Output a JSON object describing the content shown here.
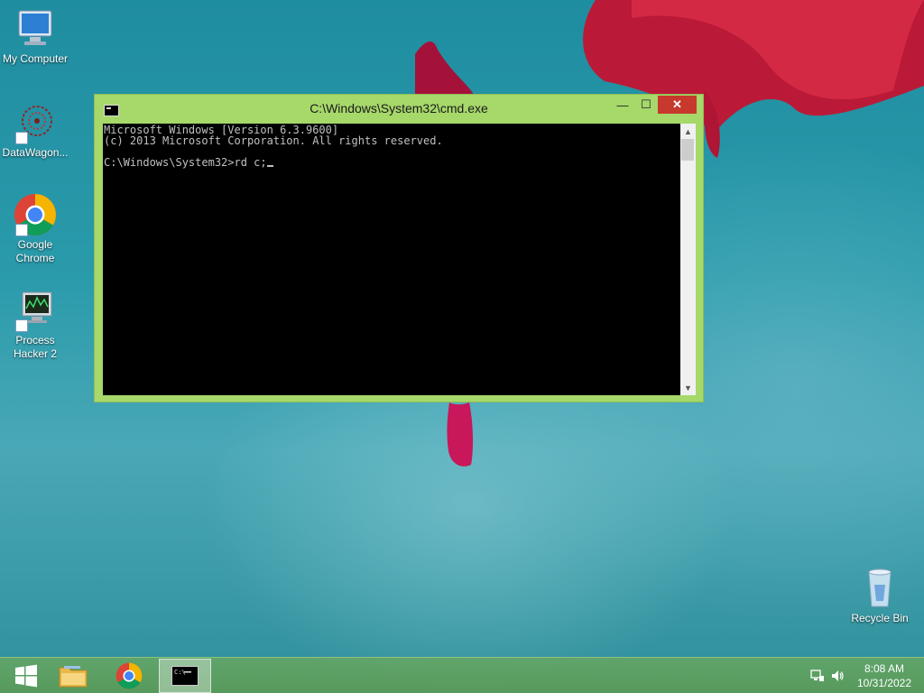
{
  "desktop": {
    "icons": [
      {
        "label": "My Computer",
        "icon": "computer-icon"
      },
      {
        "label": "DataWagon...",
        "icon": "datawagon-icon"
      },
      {
        "label": "Google Chrome",
        "icon": "chrome-icon"
      },
      {
        "label": "Process Hacker 2",
        "icon": "process-hacker-icon"
      },
      {
        "label": "Recycle Bin",
        "icon": "recycle-bin-icon"
      }
    ]
  },
  "cmd": {
    "title": "C:\\Windows\\System32\\cmd.exe",
    "minimize_label": "—",
    "maximize_label": "☐",
    "close_label": "✕",
    "lines": [
      "Microsoft Windows [Version 6.3.9600]",
      "(c) 2013 Microsoft Corporation. All rights reserved.",
      "",
      "C:\\Windows\\System32>rd c;"
    ]
  },
  "taskbar": {
    "items": [
      {
        "name": "start-button",
        "icon": "windows-logo-icon"
      },
      {
        "name": "file-explorer",
        "icon": "folder-icon"
      },
      {
        "name": "chrome",
        "icon": "chrome-icon"
      },
      {
        "name": "cmd",
        "icon": "cmd-icon",
        "active": true
      }
    ],
    "clock_time": "8:08 AM",
    "clock_date": "10/31/2022"
  },
  "colors": {
    "window_frame": "#a6d86a",
    "close_button": "#c7382d",
    "console_bg": "#000000",
    "console_text": "#c0c0c0"
  }
}
